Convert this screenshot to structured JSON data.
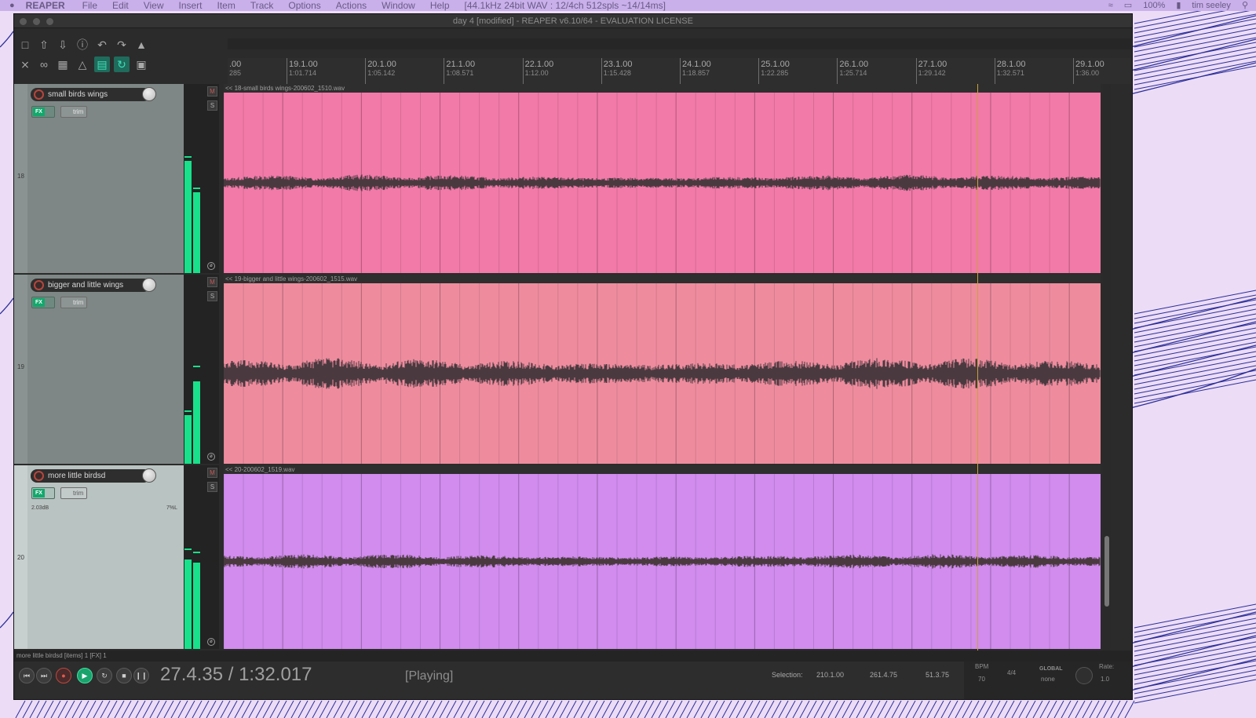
{
  "menubar": {
    "app_name": "REAPER",
    "items": [
      "File",
      "Edit",
      "View",
      "Insert",
      "Item",
      "Track",
      "Options",
      "Actions",
      "Window",
      "Help"
    ],
    "audio_status": "[44.1kHz 24bit WAV : 12/4ch 512spls ~14/14ms]",
    "battery": "100%",
    "user": "tim seeley"
  },
  "window": {
    "title": "day 4 [modified] - REAPER v6.10/64 - EVALUATION LICENSE"
  },
  "ruler": {
    "start_label": ".00",
    "start_sub": "285",
    "marks": [
      {
        "bar": "19.1.00",
        "time": "1:01.714"
      },
      {
        "bar": "20.1.00",
        "time": "1:05.142"
      },
      {
        "bar": "21.1.00",
        "time": "1:08.571"
      },
      {
        "bar": "22.1.00",
        "time": "1:12.00"
      },
      {
        "bar": "23.1.00",
        "time": "1:15.428"
      },
      {
        "bar": "24.1.00",
        "time": "1:18.857"
      },
      {
        "bar": "25.1.00",
        "time": "1:22.285"
      },
      {
        "bar": "26.1.00",
        "time": "1:25.714"
      },
      {
        "bar": "27.1.00",
        "time": "1:29.142"
      },
      {
        "bar": "28.1.00",
        "time": "1:32.571"
      },
      {
        "bar": "29.1.00",
        "time": "1:36.00"
      }
    ]
  },
  "tracks": [
    {
      "number": "18",
      "name": "small birds wings",
      "item": "<< 18-small birds wings-200602_1510.wav",
      "color": "#f27aa8",
      "fx": "FX",
      "trim": "trim"
    },
    {
      "number": "19",
      "name": "bigger and little wings",
      "item": "<< 19-bigger and little wings-200602_1515.wav",
      "color": "#ee8c9e",
      "fx": "FX",
      "trim": "trim"
    },
    {
      "number": "20",
      "name": "more little birdsd",
      "item": "<< 20-200602_1519.wav",
      "color": "#d18cee",
      "fx": "FX",
      "trim": "trim",
      "volume": "2.03dB",
      "pan": "7%L"
    }
  ],
  "buttons": {
    "mute": "M",
    "solo": "S"
  },
  "status_line": "more little birdsd [items] 1 [FX] 1",
  "transport": {
    "time": "27.4.35 / 1:32.017",
    "state": "[Playing]",
    "selection_label": "Selection:",
    "selection_start": "210.1.00",
    "selection_end": "261.4.75",
    "selection_length": "51.3.75",
    "bpm_label": "BPM",
    "bpm": "70",
    "time_sig": "4/4",
    "global_label": "GLOBAL",
    "global_value": "none",
    "rate_label": "Rate:",
    "rate": "1.0"
  },
  "colors": {
    "meter": "#19e08a",
    "playhead": "#c9a23a",
    "waveform": "#4a3a40"
  }
}
